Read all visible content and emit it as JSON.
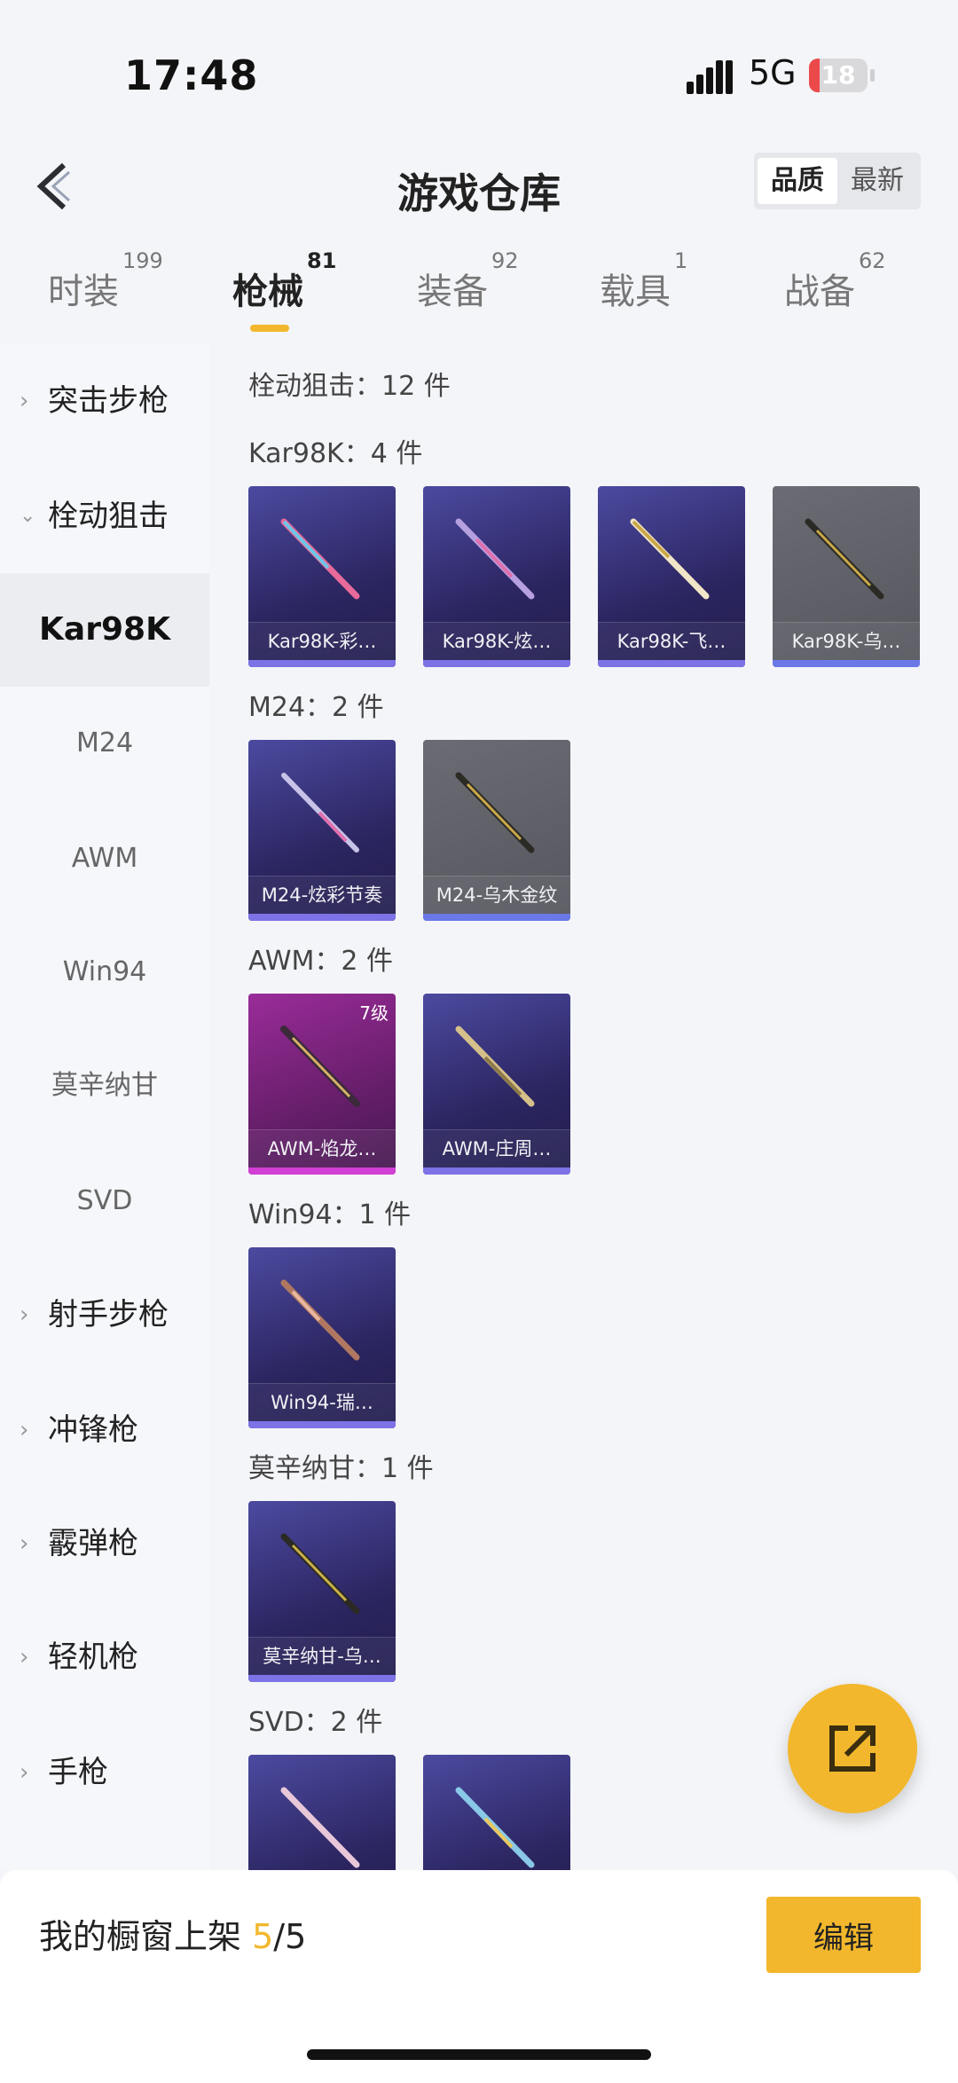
{
  "status": {
    "time": "17:48",
    "network": "5G",
    "battery": "18"
  },
  "header": {
    "title": "游戏仓库",
    "sort_quality": "品质",
    "sort_latest": "最新"
  },
  "tabs": [
    {
      "label": "时装",
      "count": "199"
    },
    {
      "label": "枪械",
      "count": "81"
    },
    {
      "label": "装备",
      "count": "92"
    },
    {
      "label": "载具",
      "count": "1"
    },
    {
      "label": "战备",
      "count": "62"
    }
  ],
  "sidebar": {
    "items": [
      {
        "label": "突击步枪",
        "kind": "category"
      },
      {
        "label": "栓动狙击",
        "kind": "category-expanded"
      },
      {
        "label": "Kar98K",
        "kind": "sub-selected"
      },
      {
        "label": "M24",
        "kind": "sub"
      },
      {
        "label": "AWM",
        "kind": "sub"
      },
      {
        "label": "Win94",
        "kind": "sub"
      },
      {
        "label": "莫辛纳甘",
        "kind": "sub"
      },
      {
        "label": "SVD",
        "kind": "sub"
      },
      {
        "label": "射手步枪",
        "kind": "category"
      },
      {
        "label": "冲锋枪",
        "kind": "category"
      },
      {
        "label": "霰弹枪",
        "kind": "category"
      },
      {
        "label": "轻机枪",
        "kind": "category"
      },
      {
        "label": "手枪",
        "kind": "category"
      }
    ]
  },
  "content": {
    "summary": "栓动狙击：12 件",
    "groups": [
      {
        "label": "Kar98K：4 件",
        "items": [
          {
            "name": "Kar98K-彩…",
            "rarity": "purple"
          },
          {
            "name": "Kar98K-炫…",
            "rarity": "purple"
          },
          {
            "name": "Kar98K-飞…",
            "rarity": "purple"
          },
          {
            "name": "Kar98K-乌…",
            "rarity": "gray"
          }
        ]
      },
      {
        "label": "M24：2 件",
        "items": [
          {
            "name": "M24-炫彩节奏",
            "rarity": "purple"
          },
          {
            "name": "M24-乌木金纹",
            "rarity": "gray"
          }
        ]
      },
      {
        "label": "AWM：2 件",
        "items": [
          {
            "name": "AWM-焰龙…",
            "rarity": "pink",
            "level": "7级"
          },
          {
            "name": "AWM-庄周…",
            "rarity": "purple"
          }
        ]
      },
      {
        "label": "Win94：1 件",
        "items": [
          {
            "name": "Win94-瑞…",
            "rarity": "purple"
          }
        ]
      },
      {
        "label": "莫辛纳甘：1 件",
        "items": [
          {
            "name": "莫辛纳甘-乌…",
            "rarity": "purple"
          }
        ]
      },
      {
        "label": "SVD：2 件",
        "items": [
          {
            "name": "",
            "rarity": "purple"
          },
          {
            "name": "",
            "rarity": "purple"
          }
        ]
      }
    ]
  },
  "bottom": {
    "shelf_label": "我的橱窗上架",
    "shelf_count": "5",
    "shelf_total": "/5",
    "edit_label": "编辑"
  },
  "colors": {
    "accent": "#f2b72c",
    "purple_card": "#2b2560",
    "gray_card": "#5a5b62",
    "pink_card": "#7b1f7f"
  }
}
